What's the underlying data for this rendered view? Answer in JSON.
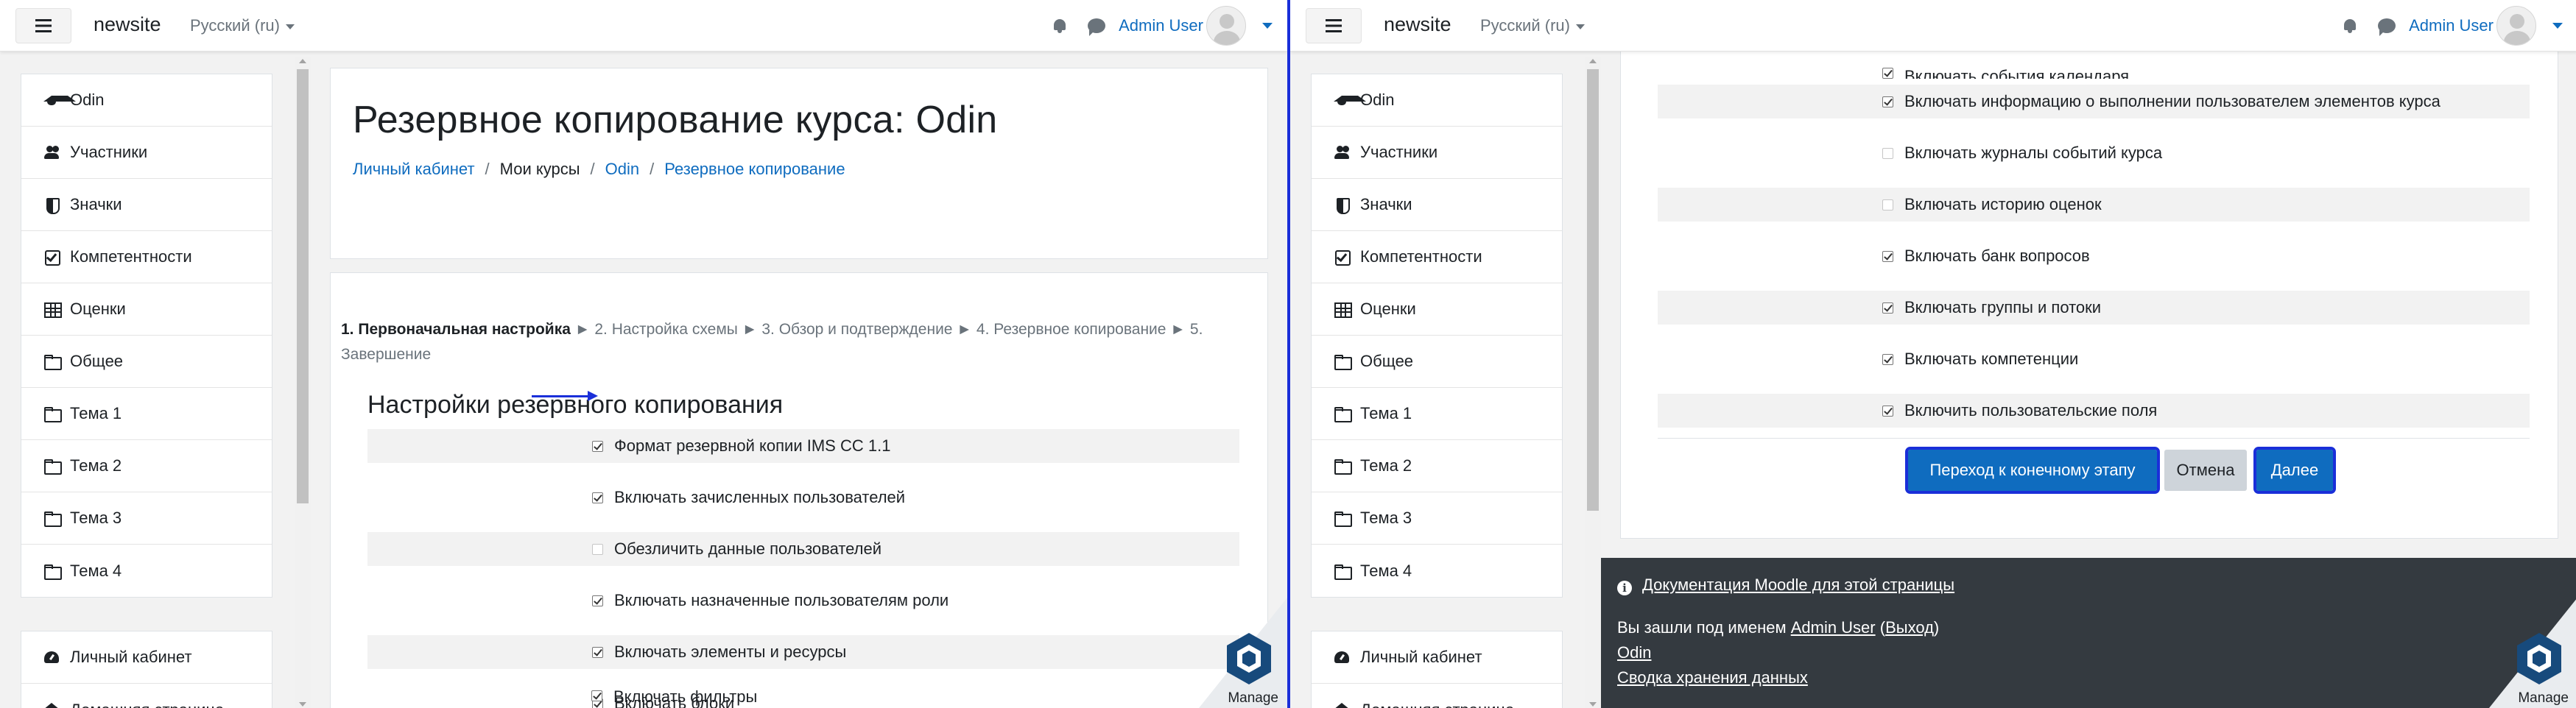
{
  "navbar": {
    "site_name": "newsite",
    "language": "Русский (ru)",
    "user_name": "Admin User"
  },
  "sidebar": {
    "course_items": [
      {
        "label": "Odin",
        "icon": "graduation-cap-icon"
      },
      {
        "label": "Участники",
        "icon": "users-icon"
      },
      {
        "label": "Значки",
        "icon": "shield-icon"
      },
      {
        "label": "Компетентности",
        "icon": "check-square-icon"
      },
      {
        "label": "Оценки",
        "icon": "table-icon"
      },
      {
        "label": "Общее",
        "icon": "folder-icon"
      },
      {
        "label": "Тема 1",
        "icon": "folder-icon"
      },
      {
        "label": "Тема 2",
        "icon": "folder-icon"
      },
      {
        "label": "Тема 3",
        "icon": "folder-icon"
      },
      {
        "label": "Тема 4",
        "icon": "folder-icon"
      }
    ],
    "site_items": [
      {
        "label": "Личный кабинет",
        "icon": "dashboard-icon"
      },
      {
        "label": "Домашняя страница",
        "icon": "home-icon"
      }
    ]
  },
  "left": {
    "page_title": "Резервное копирование курса: Odin",
    "breadcrumb": {
      "dashboard": "Личный кабинет",
      "my_courses": "Мои курсы",
      "course": "Odin",
      "backup": "Резервное копирование"
    },
    "steps": {
      "current": "1. Первоначальная настройка",
      "rest": " ► 2. Настройка схемы ► 3. Обзор и подтверждение ► 4. Резервное копирование ► 5. Завершение"
    },
    "section_title": "Настройки резервного копирования",
    "settings": [
      {
        "label": "Формат резервной копии IMS CC 1.1",
        "checked": true
      },
      {
        "label": "Включать зачисленных пользователей",
        "checked": true
      },
      {
        "label": "Обезличить данные пользователей",
        "checked": false
      },
      {
        "label": "Включать назначенные пользователям роли",
        "checked": true
      },
      {
        "label": "Включать элементы и ресурсы",
        "checked": true
      },
      {
        "label": "Включать блоки",
        "checked": true
      },
      {
        "label": "Включать фильтры",
        "checked": true
      }
    ]
  },
  "right": {
    "partial_top_label": "Включать события календаря",
    "settings": [
      {
        "label": "Включать информацию о выполнении пользователем элементов курса",
        "checked": true
      },
      {
        "label": "Включать журналы событий курса",
        "checked": false
      },
      {
        "label": "Включать историю оценок",
        "checked": false
      },
      {
        "label": "Включать банк вопросов",
        "checked": true
      },
      {
        "label": "Включать группы и потоки",
        "checked": true
      },
      {
        "label": "Включать компетенции",
        "checked": true
      },
      {
        "label": "Включить пользовательские поля",
        "checked": true
      }
    ],
    "buttons": {
      "jump_final": "Переход к конечному этапу",
      "cancel": "Отмена",
      "next": "Далее"
    }
  },
  "footer": {
    "docs_link": "Документация Moodle для этой страницы",
    "logged_in_prefix": "Вы зашли под именем ",
    "user_link": "Admin User",
    "logout_open": " (",
    "logout_link": "Выход",
    "logout_close": ")",
    "course_link": "Odin",
    "data_retention_link": "Сводка хранения данных"
  },
  "manage_badge": "Manage",
  "colors": {
    "accent": "#0f6cbf",
    "highlight": "#1a2fd9",
    "footer_bg": "#343a40"
  }
}
